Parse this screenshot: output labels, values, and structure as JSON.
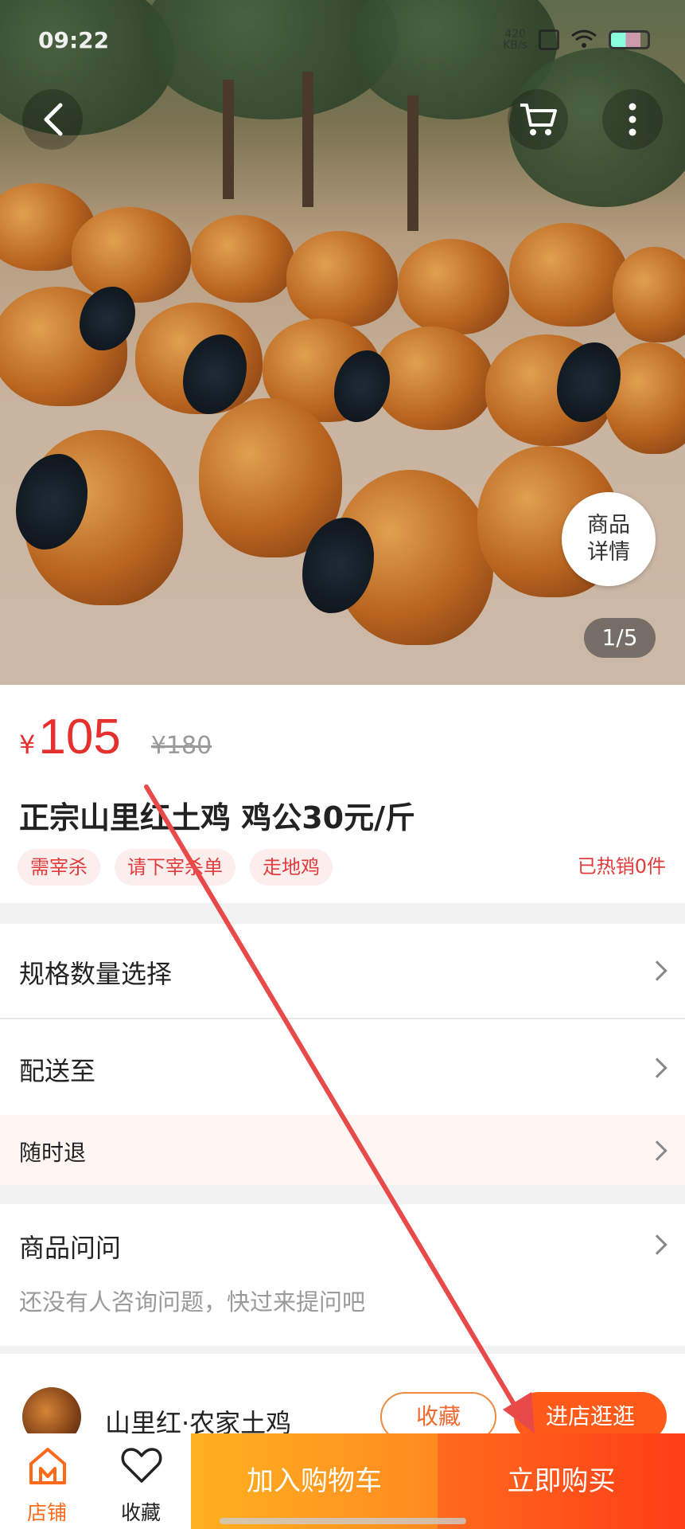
{
  "status_bar": {
    "time": "09:22",
    "network_speed": "420\nKB/s"
  },
  "hero": {
    "detail_badge_line1": "商品",
    "detail_badge_line2": "详情",
    "page_indicator": "1/5",
    "icons": [
      "back-icon",
      "cart-icon",
      "more-icon"
    ]
  },
  "product": {
    "price_symbol": "¥",
    "price": "105",
    "original_price": "¥180",
    "title": "正宗山里红土鸡 鸡公30元/斤",
    "tags": [
      "需宰杀",
      "请下宰杀单",
      "走地鸡"
    ],
    "sold_text": "已热销0件"
  },
  "options": {
    "spec": "规格数量选择",
    "delivery": "配送至",
    "return_policy": "随时退"
  },
  "qa": {
    "title": "商品问问",
    "empty_text": "还没有人咨询问题，快过来提问吧"
  },
  "shop": {
    "name": "山里红·农家土鸡",
    "favorite_button": "收藏",
    "visit_button": "进店逛逛"
  },
  "bottom_bar": {
    "store_label": "店铺",
    "favorite_label": "收藏",
    "add_to_cart": "加入购物车",
    "buy_now": "立即购买"
  },
  "colors": {
    "price_red": "#e5302e",
    "accent_orange": "#ff6a1a",
    "annotation_arrow": "#e84a4a"
  }
}
